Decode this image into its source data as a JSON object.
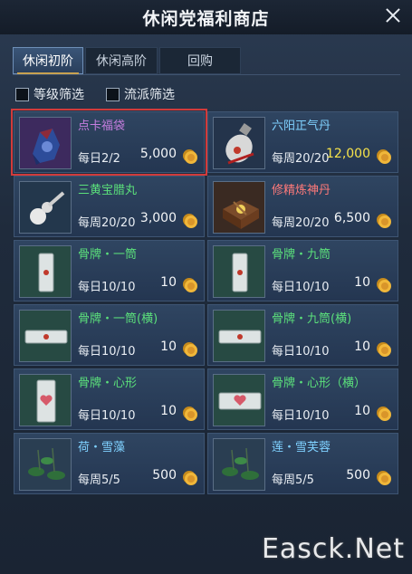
{
  "title": "休闲党福利商店",
  "tabs": [
    {
      "label": "休闲初阶",
      "active": true
    },
    {
      "label": "休闲高阶",
      "active": false
    },
    {
      "label": "回购",
      "active": false
    }
  ],
  "filters": [
    {
      "label": "等级筛选",
      "checked": false
    },
    {
      "label": "流派筛选",
      "checked": false
    }
  ],
  "items": [
    {
      "name": "点卡福袋",
      "limit": "每日2/2",
      "price": "5,000",
      "name_color": "#c77ee0",
      "icon": "bag-icon",
      "selected": true
    },
    {
      "name": "六阳正气丹",
      "limit": "每周20/20",
      "price": "12,000",
      "name_color": "#7fd1ff",
      "price_color": "#f6e34a",
      "icon": "pill-bottle-icon"
    },
    {
      "name": "三黄宝腊丸",
      "limit": "每周20/20",
      "price": "3,000",
      "name_color": "#5be07b",
      "icon": "gourd-icon"
    },
    {
      "name": "修精炼神丹",
      "limit": "每周20/20",
      "price": "6,500",
      "name_color": "#ff7a7a",
      "icon": "treasure-box-icon"
    },
    {
      "name": "骨牌・一筒",
      "limit": "每日10/10",
      "price": "10",
      "name_color": "#5be07b",
      "icon": "domino-tile-icon"
    },
    {
      "name": "骨牌・九筒",
      "limit": "每日10/10",
      "price": "10",
      "name_color": "#5be07b",
      "icon": "domino-tile-icon"
    },
    {
      "name": "骨牌・一筒(横)",
      "limit": "每日10/10",
      "price": "10",
      "name_color": "#5be07b",
      "icon": "domino-tile-horizontal-icon"
    },
    {
      "name": "骨牌・九筒(横)",
      "limit": "每日10/10",
      "price": "10",
      "name_color": "#5be07b",
      "icon": "domino-tile-horizontal-icon"
    },
    {
      "name": "骨牌・心形",
      "limit": "每日10/10",
      "price": "10",
      "name_color": "#5be07b",
      "icon": "domino-heart-icon"
    },
    {
      "name": "骨牌・心形（横）",
      "limit": "每日10/10",
      "price": "10",
      "name_color": "#5be07b",
      "icon": "domino-heart-horizontal-icon"
    },
    {
      "name": "荷・雪藻",
      "limit": "每周5/5",
      "price": "500",
      "name_color": "#7fd1ff",
      "icon": "lotus-icon"
    },
    {
      "name": "莲・雪芙蓉",
      "limit": "每周5/5",
      "price": "500",
      "name_color": "#7fd1ff",
      "icon": "lotus-icon"
    }
  ],
  "currency_icon": "gold-coin-icon",
  "watermark": "Easck.Net"
}
